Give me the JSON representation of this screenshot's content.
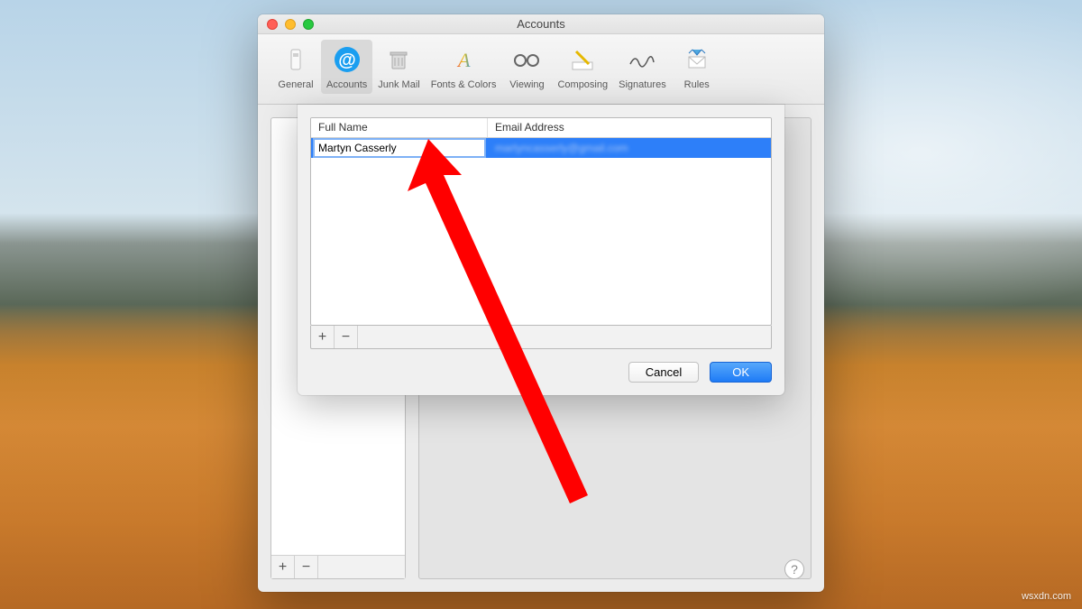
{
  "watermark": "wsxdn.com",
  "window": {
    "title": "Accounts",
    "toolbar": [
      {
        "label": "General",
        "icon": "slider"
      },
      {
        "label": "Accounts",
        "icon": "at",
        "active": true
      },
      {
        "label": "Junk Mail",
        "icon": "trash"
      },
      {
        "label": "Fonts & Colors",
        "icon": "fonts"
      },
      {
        "label": "Viewing",
        "icon": "glasses"
      },
      {
        "label": "Composing",
        "icon": "pen"
      },
      {
        "label": "Signatures",
        "icon": "signature"
      },
      {
        "label": "Rules",
        "icon": "rules"
      }
    ],
    "sidebar": {
      "add_label": "+",
      "remove_label": "−"
    },
    "help_label": "?"
  },
  "dialog": {
    "headers": {
      "name": "Full Name",
      "email": "Email Address"
    },
    "row": {
      "name": "Martyn Casserly",
      "email": "martyncasserly@gmail.com"
    },
    "add_label": "+",
    "remove_label": "−",
    "cancel": "Cancel",
    "ok": "OK"
  }
}
